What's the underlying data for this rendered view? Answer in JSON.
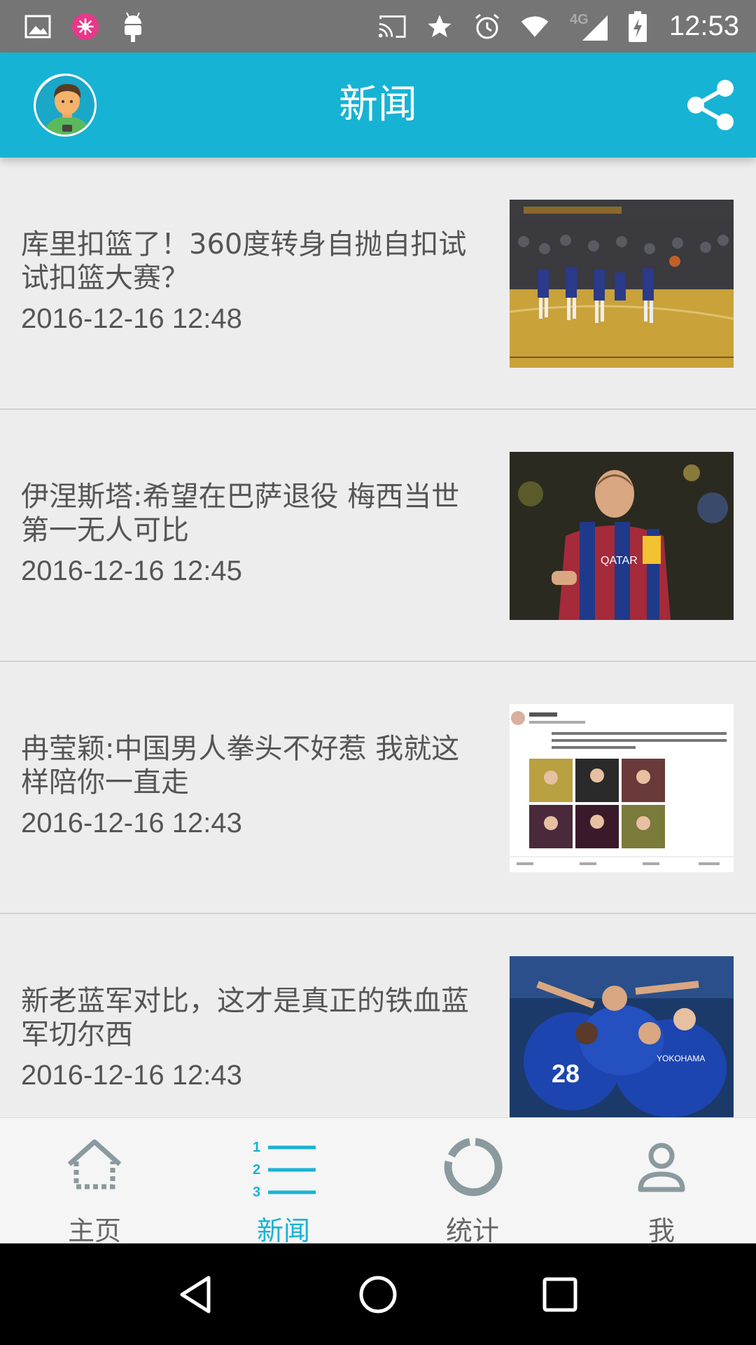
{
  "status_bar": {
    "time": "12:53",
    "network": "4G",
    "icons": [
      "image-icon",
      "app-notification-icon",
      "android-icon",
      "cast-icon",
      "star-icon",
      "alarm-icon",
      "wifi-icon",
      "signal-icon",
      "battery-charging-icon"
    ]
  },
  "app_bar": {
    "title": "新闻",
    "left_icon": "avatar",
    "right_icon": "share-icon",
    "color": "#17b3d4"
  },
  "news": [
    {
      "title": "库里扣篮了！360度转身自抛自扣试试扣篮大赛？",
      "time": "2016-12-16 12:48",
      "thumb": "basketball-court-photo"
    },
    {
      "title": "伊涅斯塔:希望在巴萨退役 梅西当世第一无人可比",
      "time": "2016-12-16 12:45",
      "thumb": "soccer-player-photo"
    },
    {
      "title": "冉莹颖:中国男人拳头不好惹 我就这样陪你一直走",
      "time": "2016-12-16 12:43",
      "thumb": "weibo-post-screenshot"
    },
    {
      "title": "新老蓝军对比，这才是真正的铁血蓝军切尔西",
      "time": "2016-12-16 12:43",
      "thumb": "team-celebration-photo"
    }
  ],
  "tabs": [
    {
      "label": "主页",
      "icon": "home-icon",
      "active": false
    },
    {
      "label": "新闻",
      "icon": "numbered-list-icon",
      "active": true
    },
    {
      "label": "统计",
      "icon": "chart-ring-icon",
      "active": false
    },
    {
      "label": "我",
      "icon": "person-icon",
      "active": false
    }
  ],
  "nav_bar": {
    "icons": [
      "back-icon",
      "home-circle-icon",
      "recents-icon"
    ]
  },
  "colors": {
    "accent": "#17b3d4",
    "status_bar": "#757575",
    "text": "#555555",
    "tab_inactive": "#666666"
  }
}
